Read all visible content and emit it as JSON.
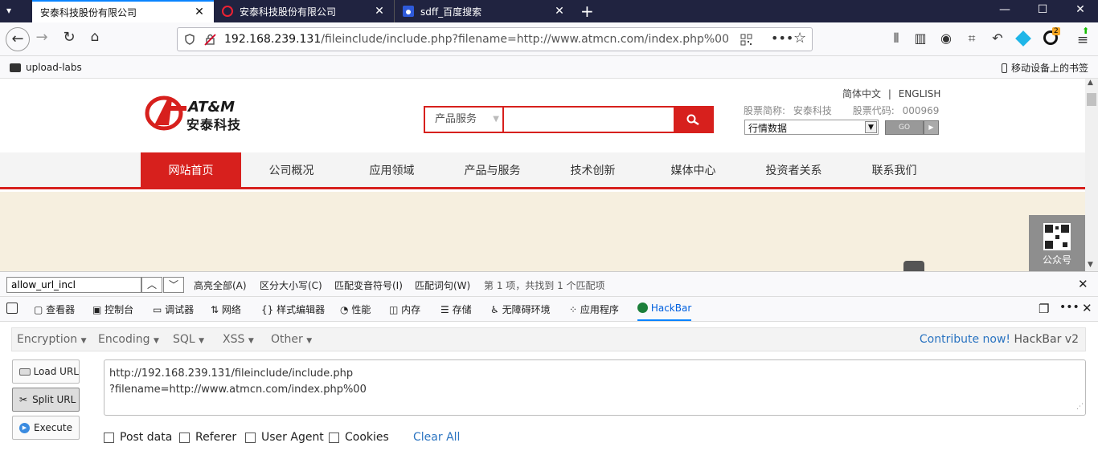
{
  "tabs": [
    {
      "title": "安泰科技股份有限公司",
      "active": true
    },
    {
      "title": "安泰科技股份有限公司",
      "active": false
    },
    {
      "title": "sdff_百度搜索",
      "active": false
    }
  ],
  "nav": {
    "url_host": "192.168.239.131",
    "url_rest": "/fileinclude/include.php?filename=http://www.atmcn.com/index.php%00"
  },
  "bookmarks": {
    "item": "upload-labs",
    "mobile": "移动设备上的书签"
  },
  "site": {
    "lang_cn": "简体中文",
    "lang_sep": "|",
    "lang_en": "ENGLISH",
    "logo_en": "AT&M",
    "logo_cn": "安泰科技",
    "search_category": "产品服务",
    "stock_name_label": "股票简称:",
    "stock_name": "安泰科技",
    "stock_code_label": "股票代码:",
    "stock_code": "000969",
    "quote_select": "行情数据",
    "go": "GO",
    "menu": [
      "网站首页",
      "公司概况",
      "应用领域",
      "产品与服务",
      "技术创新",
      "媒体中心",
      "投资者关系",
      "联系我们"
    ],
    "qr_label": "公众号"
  },
  "findbar": {
    "value": "allow_url_incl",
    "highlight_all": "高亮全部(A)",
    "match_case": "区分大小写(C)",
    "match_diacritics": "匹配变音符号(I)",
    "whole_words": "匹配词句(W)",
    "status": "第 1 项，共找到 1 个匹配项"
  },
  "devtools": {
    "tabs": [
      "查看器",
      "控制台",
      "调试器",
      "网络",
      "样式编辑器",
      "性能",
      "内存",
      "存储",
      "无障碍环境",
      "应用程序",
      "HackBar"
    ]
  },
  "hackbar": {
    "menus": [
      "Encryption",
      "Encoding",
      "SQL",
      "XSS",
      "Other"
    ],
    "contribute": "Contribute now!",
    "version": "HackBar v2",
    "load_url": "Load URL",
    "split_url": "Split URL",
    "execute": "Execute",
    "url_line1": "http://192.168.239.131/fileinclude/include.php",
    "url_line2": "?filename=http://www.atmcn.com/index.php%00",
    "checkboxes": [
      "Post data",
      "Referer",
      "User Agent",
      "Cookies"
    ],
    "clear_all": "Clear All"
  },
  "colors": {
    "brand_red": "#d7201d",
    "accent_blue": "#0a84ff",
    "tabstrip": "#202340",
    "link_blue": "#2b74c1"
  }
}
